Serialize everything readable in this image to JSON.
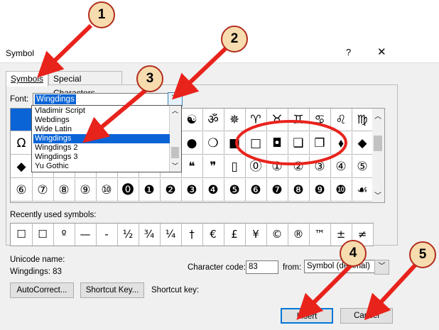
{
  "window": {
    "title": "Symbol",
    "help": "?",
    "close": "✕"
  },
  "tabs": [
    {
      "label": "Symbols",
      "active": true
    },
    {
      "label": "Special Characters",
      "active": false
    }
  ],
  "font": {
    "label": "Font:",
    "value": "Wingdings",
    "options": [
      "Vladimir Script",
      "Webdings",
      "Wide Latin",
      "Wingdings",
      "Wingdings 2",
      "Wingdings 3",
      "Yu Gothic"
    ],
    "selected": "Wingdings"
  },
  "grid": {
    "rows": [
      [
        "",
        "",
        "",
        "",
        "",
        "",
        "",
        "",
        "☯",
        "ॐ",
        "✵",
        "♈",
        "♉",
        "♊",
        "♋",
        "♌",
        "♍"
      ],
      [
        "Ω",
        "",
        "",
        "",
        "",
        "",
        "",
        "",
        "●",
        "❍",
        "■",
        "□",
        "◘",
        "❑",
        "❒",
        "⬧",
        "◆"
      ],
      [
        "◆",
        "",
        "",
        "",
        "",
        "",
        "",
        "",
        "❝",
        "❞",
        "▯",
        "⓪",
        "①",
        "②",
        "③",
        "④",
        "⑤"
      ],
      [
        "⑥",
        "⑦",
        "⑧",
        "⑨",
        "⑩",
        "⓿",
        "❶",
        "❷",
        "❸",
        "❹",
        "❺",
        "❻",
        "❼",
        "❽",
        "❾",
        "❿",
        "☙"
      ]
    ]
  },
  "recent": {
    "label": "Recently used symbols:",
    "items": [
      "☐",
      "☐",
      "º",
      "—",
      "-",
      "½",
      "¾",
      "¼",
      "†",
      "€",
      "£",
      "¥",
      "©",
      "®",
      "™",
      "±",
      "≠"
    ]
  },
  "unicode": {
    "label": "Unicode name:",
    "value": "Wingdings: 83"
  },
  "charcode": {
    "label": "Character code:",
    "value": "83",
    "from_label": "from:",
    "from_value": "Symbol (decimal)"
  },
  "buttons": {
    "autocorrect": "AutoCorrect...",
    "shortcut_key": "Shortcut Key...",
    "shortcut_label": "Shortcut key:",
    "insert": "Insert",
    "cancel": "Cancel"
  },
  "markers": [
    "1",
    "2",
    "3",
    "4",
    "5"
  ],
  "colors": {
    "accent": "#0a64d6",
    "annotation": "#e8231c",
    "marker_fill": "#f6dcae"
  }
}
